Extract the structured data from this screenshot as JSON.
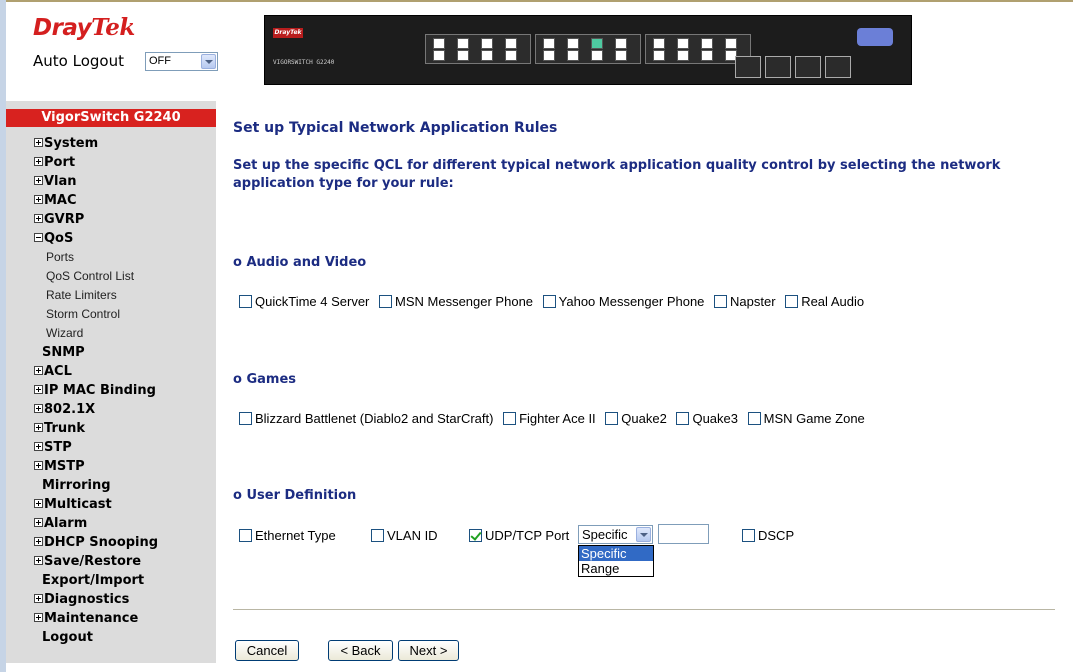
{
  "header": {
    "logo_dray": "Dray",
    "logo_tek": "Tek",
    "auto_logout_label": "Auto Logout",
    "auto_logout_value": "OFF"
  },
  "device": {
    "model_label": "VIGORSWITCH G2240",
    "brand": "DrayTek"
  },
  "sidebar": {
    "title": "VigorSwitch G2240",
    "items": [
      {
        "label": "System",
        "icon": "plus"
      },
      {
        "label": "Port",
        "icon": "plus"
      },
      {
        "label": "Vlan",
        "icon": "plus"
      },
      {
        "label": "MAC",
        "icon": "plus"
      },
      {
        "label": "GVRP",
        "icon": "plus"
      },
      {
        "label": "QoS",
        "icon": "minus"
      },
      {
        "label": "Ports",
        "sub": true
      },
      {
        "label": "QoS Control List",
        "sub": true
      },
      {
        "label": "Rate Limiters",
        "sub": true
      },
      {
        "label": "Storm Control",
        "sub": true
      },
      {
        "label": "Wizard",
        "sub": true
      },
      {
        "label": "SNMP",
        "icon": "none"
      },
      {
        "label": "ACL",
        "icon": "plus"
      },
      {
        "label": "IP MAC Binding",
        "icon": "plus"
      },
      {
        "label": "802.1X",
        "icon": "plus"
      },
      {
        "label": "Trunk",
        "icon": "plus"
      },
      {
        "label": "STP",
        "icon": "plus"
      },
      {
        "label": "MSTP",
        "icon": "plus"
      },
      {
        "label": "Mirroring",
        "icon": "none"
      },
      {
        "label": "Multicast",
        "icon": "plus"
      },
      {
        "label": "Alarm",
        "icon": "plus"
      },
      {
        "label": "DHCP Snooping",
        "icon": "plus"
      },
      {
        "label": "Save/Restore",
        "icon": "plus"
      },
      {
        "label": "Export/Import",
        "icon": "none"
      },
      {
        "label": "Diagnostics",
        "icon": "plus"
      },
      {
        "label": "Maintenance",
        "icon": "plus"
      },
      {
        "label": "Logout",
        "icon": "none"
      }
    ]
  },
  "main": {
    "title": "Set up Typical Network Application Rules",
    "description": "Set up the specific QCL for different typical network application quality control by selecting the network application type for your rule:",
    "audio_video": {
      "heading": "o Audio and Video",
      "options": [
        "QuickTime 4 Server",
        "MSN Messenger Phone",
        "Yahoo Messenger Phone",
        "Napster",
        "Real Audio"
      ]
    },
    "games": {
      "heading": "o Games",
      "options": [
        "Blizzard Battlenet (Diablo2 and StarCraft)",
        "Fighter Ace II",
        "Quake2",
        "Quake3",
        "MSN Game Zone"
      ]
    },
    "user_definition": {
      "heading": "o User Definition",
      "ethernet_type": "Ethernet Type",
      "vlan_id": "VLAN ID",
      "udp_tcp_port": "UDP/TCP Port",
      "udp_tcp_port_checked": true,
      "port_mode_value": "Specific",
      "port_mode_options": [
        "Specific",
        "Range"
      ],
      "port_value": "",
      "dscp": "DSCP"
    },
    "buttons": {
      "cancel": "Cancel",
      "back": "< Back",
      "next": "Next >"
    }
  }
}
